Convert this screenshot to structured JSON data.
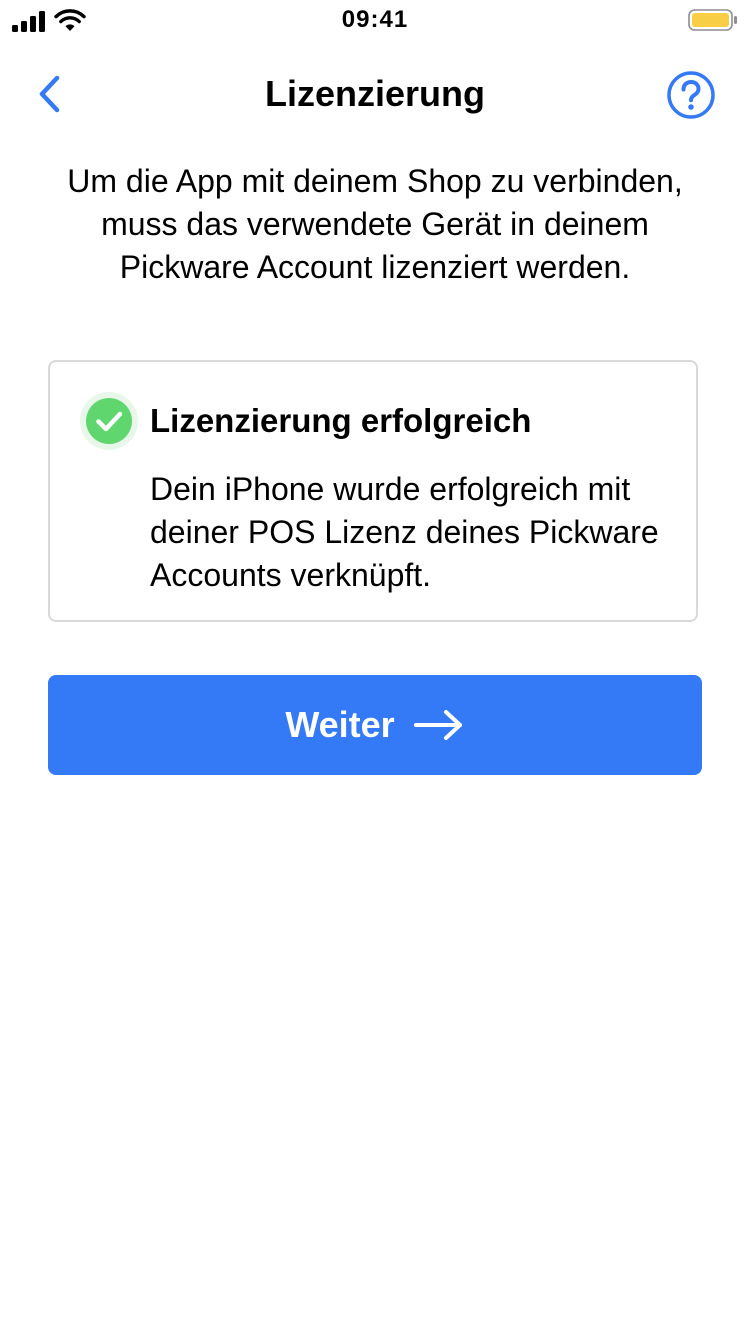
{
  "status_bar": {
    "time": "09:41",
    "icons": [
      "cellular-signal-icon",
      "wifi-icon",
      "battery-icon"
    ],
    "battery_color": "#f7ce46"
  },
  "nav": {
    "title": "Lizenzierung",
    "back_icon": "chevron-left-icon",
    "help_icon": "question-circle-icon"
  },
  "intro_text": "Um die App mit deinem Shop zu verbinden, muss das verwendete Gerät in deinem Pickware Account lizenziert werden.",
  "result_card": {
    "icon": "check-circle-icon",
    "title": "Lizenzierung erfolgreich",
    "message": "Dein iPhone wurde erfolgreich mit deiner POS Lizenz deines Pickware Accounts verknüpft."
  },
  "continue_button": {
    "label": "Weiter",
    "icon": "arrow-right-icon"
  },
  "colors": {
    "accent": "#3479f6",
    "success": "#5fd66e",
    "success_halo": "#e8f7ea",
    "border": "#d9d9d9",
    "text": "#000000",
    "background": "#ffffff"
  }
}
